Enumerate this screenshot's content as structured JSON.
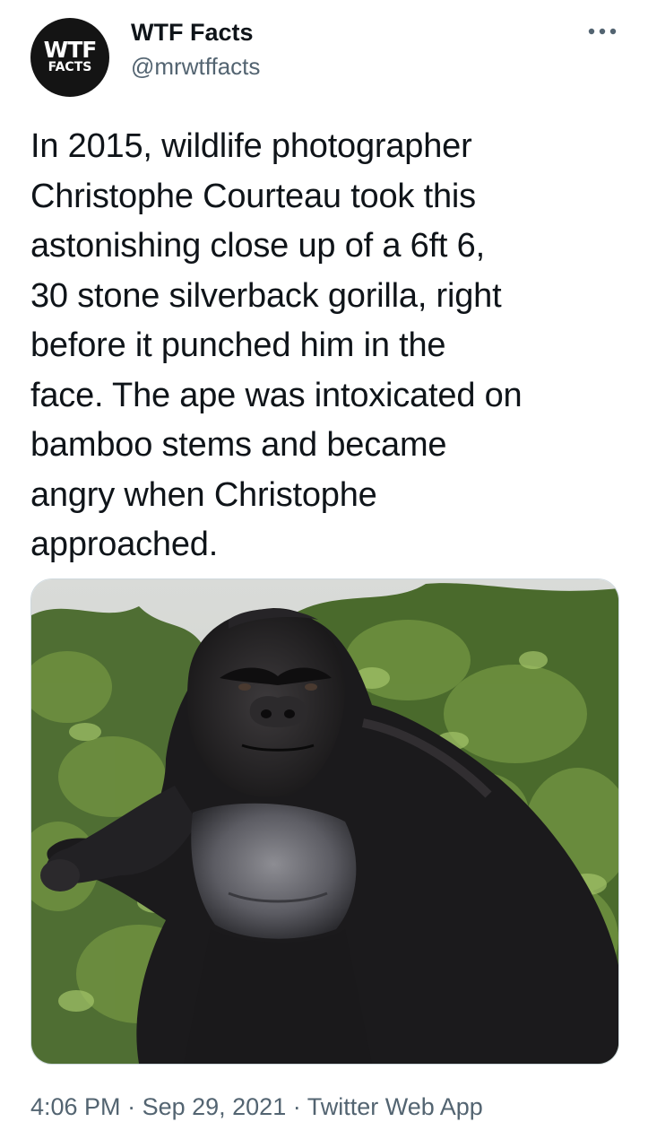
{
  "author": {
    "avatar": {
      "line1": "WTF",
      "line2": "FACTS"
    },
    "display_name": "WTF Facts",
    "handle": "@mrwtffacts"
  },
  "more_icon": "more-horizontal-icon",
  "tweet": {
    "text": "In 2015, wildlife photographer\nChristophe Courteau took this\nastonishing close up of a 6ft 6,\n30 stone silverback gorilla, right\nbefore it punched him in the\nface. The ape was intoxicated on\nbamboo stems and became\nangry when Christophe\napproached."
  },
  "media": {
    "kind": "photo",
    "subject": "silverback gorilla close-up"
  },
  "meta": {
    "time": "4:06 PM",
    "separator": " · ",
    "date": "Sep 29, 2021",
    "source": "Twitter Web App"
  },
  "colors": {
    "text_primary": "#0f1419",
    "text_secondary": "#536471",
    "border": "#cfd9de",
    "background": "#ffffff"
  }
}
